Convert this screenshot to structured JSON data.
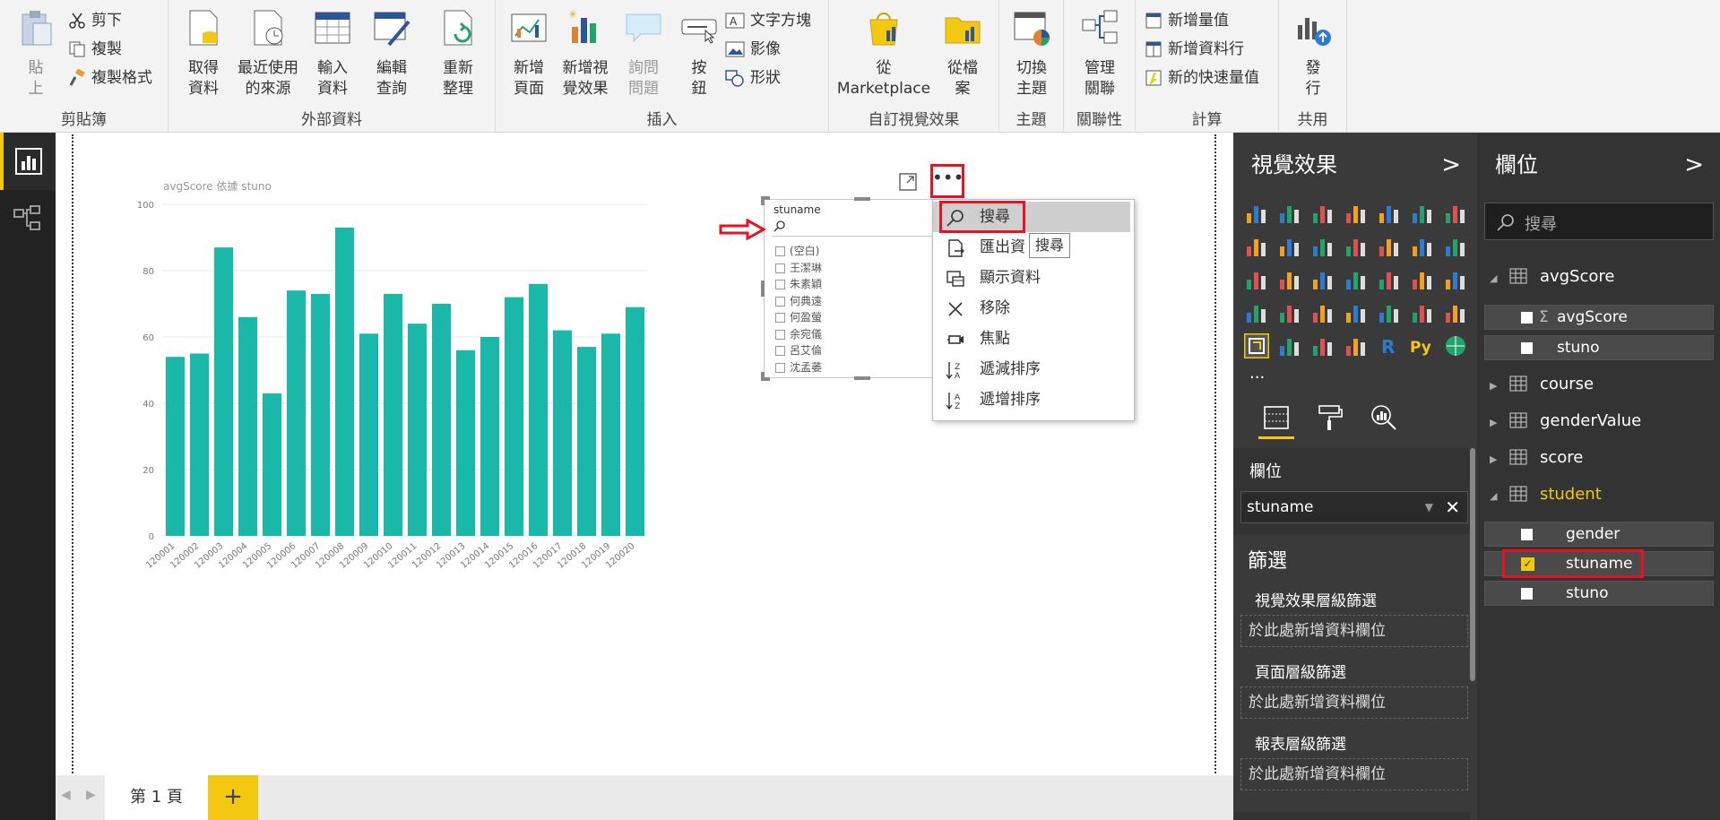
{
  "ribbon": {
    "clipboard": {
      "label": "剪貼簿",
      "paste": "貼\n上",
      "cut": "剪下",
      "copy": "複製",
      "format_painter": "複製格式"
    },
    "external_data": {
      "label": "外部資料",
      "get_data": "取得\n資料",
      "recent_sources": "最近使用\n的來源",
      "enter_data": "輸入\n資料",
      "edit_queries": "編輯\n查詢",
      "refresh": "重新\n整理"
    },
    "insert": {
      "label": "插入",
      "new_page": "新增\n頁面",
      "new_visual": "新增視\n覺效果",
      "ask_question": "詢問\n問題",
      "buttons": "按\n鈕",
      "textbox": "文字方塊",
      "image": "影像",
      "shapes": "形狀"
    },
    "custom_visuals": {
      "label": "自訂視覺效果",
      "from_marketplace": "從\nMarketplace",
      "from_file": "從檔\n案"
    },
    "themes": {
      "label": "主題",
      "switch_theme": "切換\n主題"
    },
    "relationships": {
      "label": "關聯性",
      "manage": "管理\n關聯"
    },
    "calculations": {
      "label": "計算",
      "new_measure": "新增量值",
      "new_column": "新增資料行",
      "new_quick_measure": "新的快速量值"
    },
    "share": {
      "label": "共用",
      "publish": "發\n行"
    }
  },
  "chart": {
    "title": "avgScore 依據 stuno",
    "color": "#1ab8a8"
  },
  "chart_data": {
    "type": "bar",
    "title": "avgScore 依據 stuno",
    "categories": [
      "120001",
      "120002",
      "120003",
      "120004",
      "120005",
      "120006",
      "120007",
      "120008",
      "120009",
      "120010",
      "120011",
      "120012",
      "120013",
      "120014",
      "120015",
      "120016",
      "120017",
      "120018",
      "120019",
      "120020"
    ],
    "values": [
      54,
      55,
      87,
      66,
      43,
      74,
      73,
      93,
      61,
      73,
      64,
      70,
      56,
      60,
      72,
      76,
      62,
      57,
      61,
      69
    ],
    "yticks": [
      "0",
      "20",
      "40",
      "60",
      "80",
      "100"
    ],
    "ylim": [
      0,
      100
    ],
    "grid": true,
    "color": "#1ab8a8"
  },
  "slicer": {
    "header": "stuname",
    "items": [
      "(空白)",
      "王潔琳",
      "朱素穎",
      "何典遠",
      "何盈螢",
      "余宛儀",
      "呂艾倫",
      "沈孟萎"
    ]
  },
  "context_menu": {
    "items": [
      "搜尋",
      "匯出資",
      "顯示資料",
      "移除",
      "焦點",
      "遞減排序",
      "遞增排序"
    ],
    "tooltip": "搜尋"
  },
  "pages": {
    "page1": "第 1 頁",
    "add": "+"
  },
  "viz_pane": {
    "title": "視覺效果",
    "chevron": ">",
    "more": "...",
    "fields_label": "欄位",
    "field_value": "stuname",
    "filters_title": "篩選",
    "visual_filters": "視覺效果層級篩選",
    "page_filters": "頁面層級篩選",
    "report_filters": "報表層級篩選",
    "drop_here": "於此處新增資料欄位",
    "r_label": "R",
    "py_label": "Py"
  },
  "fields_pane": {
    "title": "欄位",
    "chevron": ">",
    "search_placeholder": "搜尋",
    "tables": {
      "avgScore": {
        "name": "avgScore",
        "fields": [
          "avgScore",
          "stuno"
        ],
        "sigma": "Σ"
      },
      "course": "course",
      "genderValue": "genderValue",
      "score": "score",
      "student": {
        "name": "student",
        "fields": [
          "gender",
          "stuname",
          "stuno"
        ]
      }
    }
  }
}
